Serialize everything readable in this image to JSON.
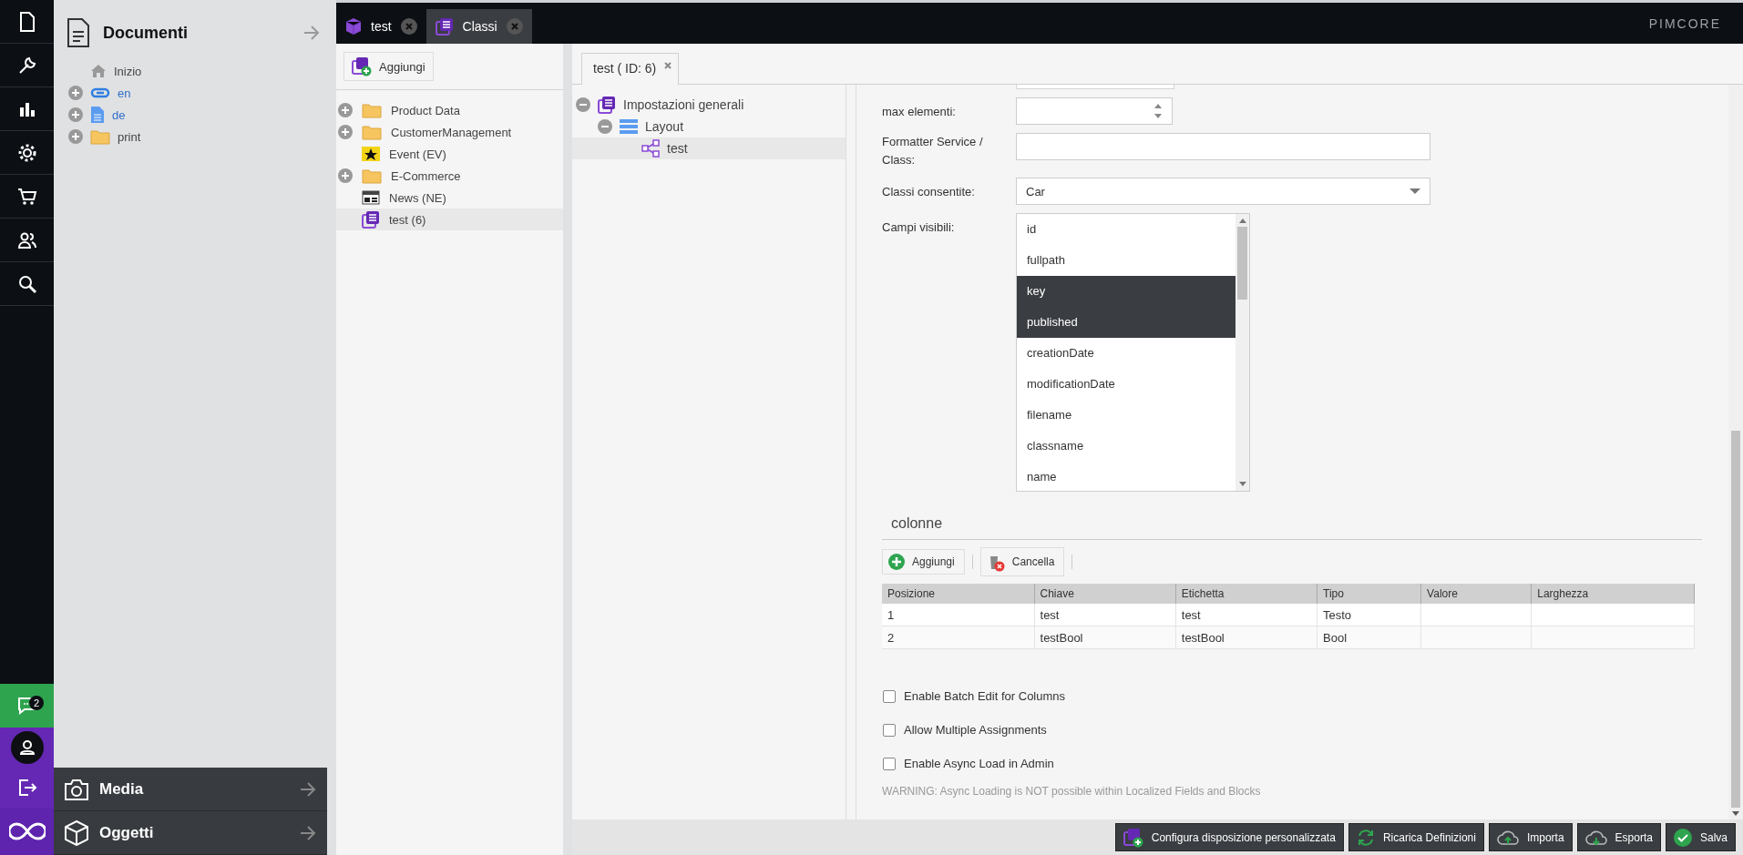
{
  "rail": {
    "chat_badge": "2"
  },
  "documents_panel": {
    "title": "Documenti",
    "tree": [
      {
        "label": "Inizio",
        "kind": "home",
        "expandable": false
      },
      {
        "label": "en",
        "kind": "link",
        "expandable": true
      },
      {
        "label": "de",
        "kind": "page",
        "expandable": true
      },
      {
        "label": "print",
        "kind": "folder",
        "expandable": true
      }
    ]
  },
  "bottom_panels": [
    {
      "title": "Media",
      "kind": "media"
    },
    {
      "title": "Oggetti",
      "kind": "objects"
    }
  ],
  "tabs": [
    {
      "label": "test",
      "kind": "object",
      "selected": false
    },
    {
      "label": "Classi",
      "kind": "classes",
      "selected": true
    }
  ],
  "logo": "PIMCORE",
  "class_panel": {
    "add_button": "Aggiungi",
    "tree": [
      {
        "label": "Product Data",
        "kind": "folder",
        "expandable": true,
        "selected": false
      },
      {
        "label": "CustomerManagement",
        "kind": "folder",
        "expandable": true,
        "selected": false
      },
      {
        "label": "Event (EV)",
        "kind": "event",
        "expandable": false,
        "selected": false
      },
      {
        "label": "E-Commerce",
        "kind": "folder",
        "expandable": true,
        "selected": false
      },
      {
        "label": "News (NE)",
        "kind": "news",
        "expandable": false,
        "selected": false
      },
      {
        "label": "test (6)",
        "kind": "class",
        "expandable": false,
        "selected": true
      }
    ]
  },
  "editor": {
    "tab": "test ( ID: 6)",
    "layout_tree": [
      {
        "label": "Impostazioni generali",
        "kind": "class",
        "expanded": true,
        "selected": false,
        "children": [
          {
            "label": "Layout",
            "kind": "layout",
            "expanded": true,
            "selected": false,
            "children": [
              {
                "label": "test",
                "kind": "relation",
                "selected": true
              }
            ]
          }
        ]
      }
    ],
    "form": [
      {
        "kind": "partial"
      },
      {
        "label": "max elementi:",
        "kind": "number"
      },
      {
        "label": "Formatter Service / Class:",
        "kind": "text"
      },
      {
        "label": "Classi consentite:",
        "kind": "select",
        "value": "Car"
      },
      {
        "label": "Campi visibili:",
        "kind": "multiselect",
        "options": [
          {
            "label": "id",
            "selected": false
          },
          {
            "label": "fullpath",
            "selected": false
          },
          {
            "label": "key",
            "selected": true
          },
          {
            "label": "published",
            "selected": true
          },
          {
            "label": "creationDate",
            "selected": false
          },
          {
            "label": "modificationDate",
            "selected": false
          },
          {
            "label": "filename",
            "selected": false
          },
          {
            "label": "classname",
            "selected": false
          },
          {
            "label": "name",
            "selected": false
          }
        ]
      }
    ],
    "columns": {
      "title": "colonne",
      "buttons": [
        {
          "label": "Aggiungi",
          "kind": "add"
        },
        {
          "label": "Cancella",
          "kind": "delete"
        }
      ],
      "table": {
        "columns": [
          "Posizione",
          "Chiave",
          "Etichetta",
          "Tipo",
          "Valore",
          "Larghezza"
        ],
        "rows": [
          [
            "1",
            "test",
            "test",
            "Testo"
          ],
          [
            "2",
            "testBool",
            "testBool",
            "Bool"
          ]
        ]
      }
    },
    "options": [
      {
        "label": "Enable Batch Edit for Columns",
        "checked": false
      },
      {
        "label": "Allow Multiple Assignments",
        "checked": false
      },
      {
        "label": "Enable Async Load in Admin",
        "checked": false
      }
    ],
    "warning": "WARNING: Async Loading is NOT possible within Localized Fields and Blocks"
  },
  "toolbar": [
    {
      "label": "Configura disposizione personalizzata",
      "kind": "layout"
    },
    {
      "label": "Ricarica Definizioni",
      "kind": "reload"
    },
    {
      "label": "Importa",
      "kind": "import"
    },
    {
      "label": "Esporta",
      "kind": "export"
    },
    {
      "label": "Salva",
      "kind": "save"
    }
  ]
}
